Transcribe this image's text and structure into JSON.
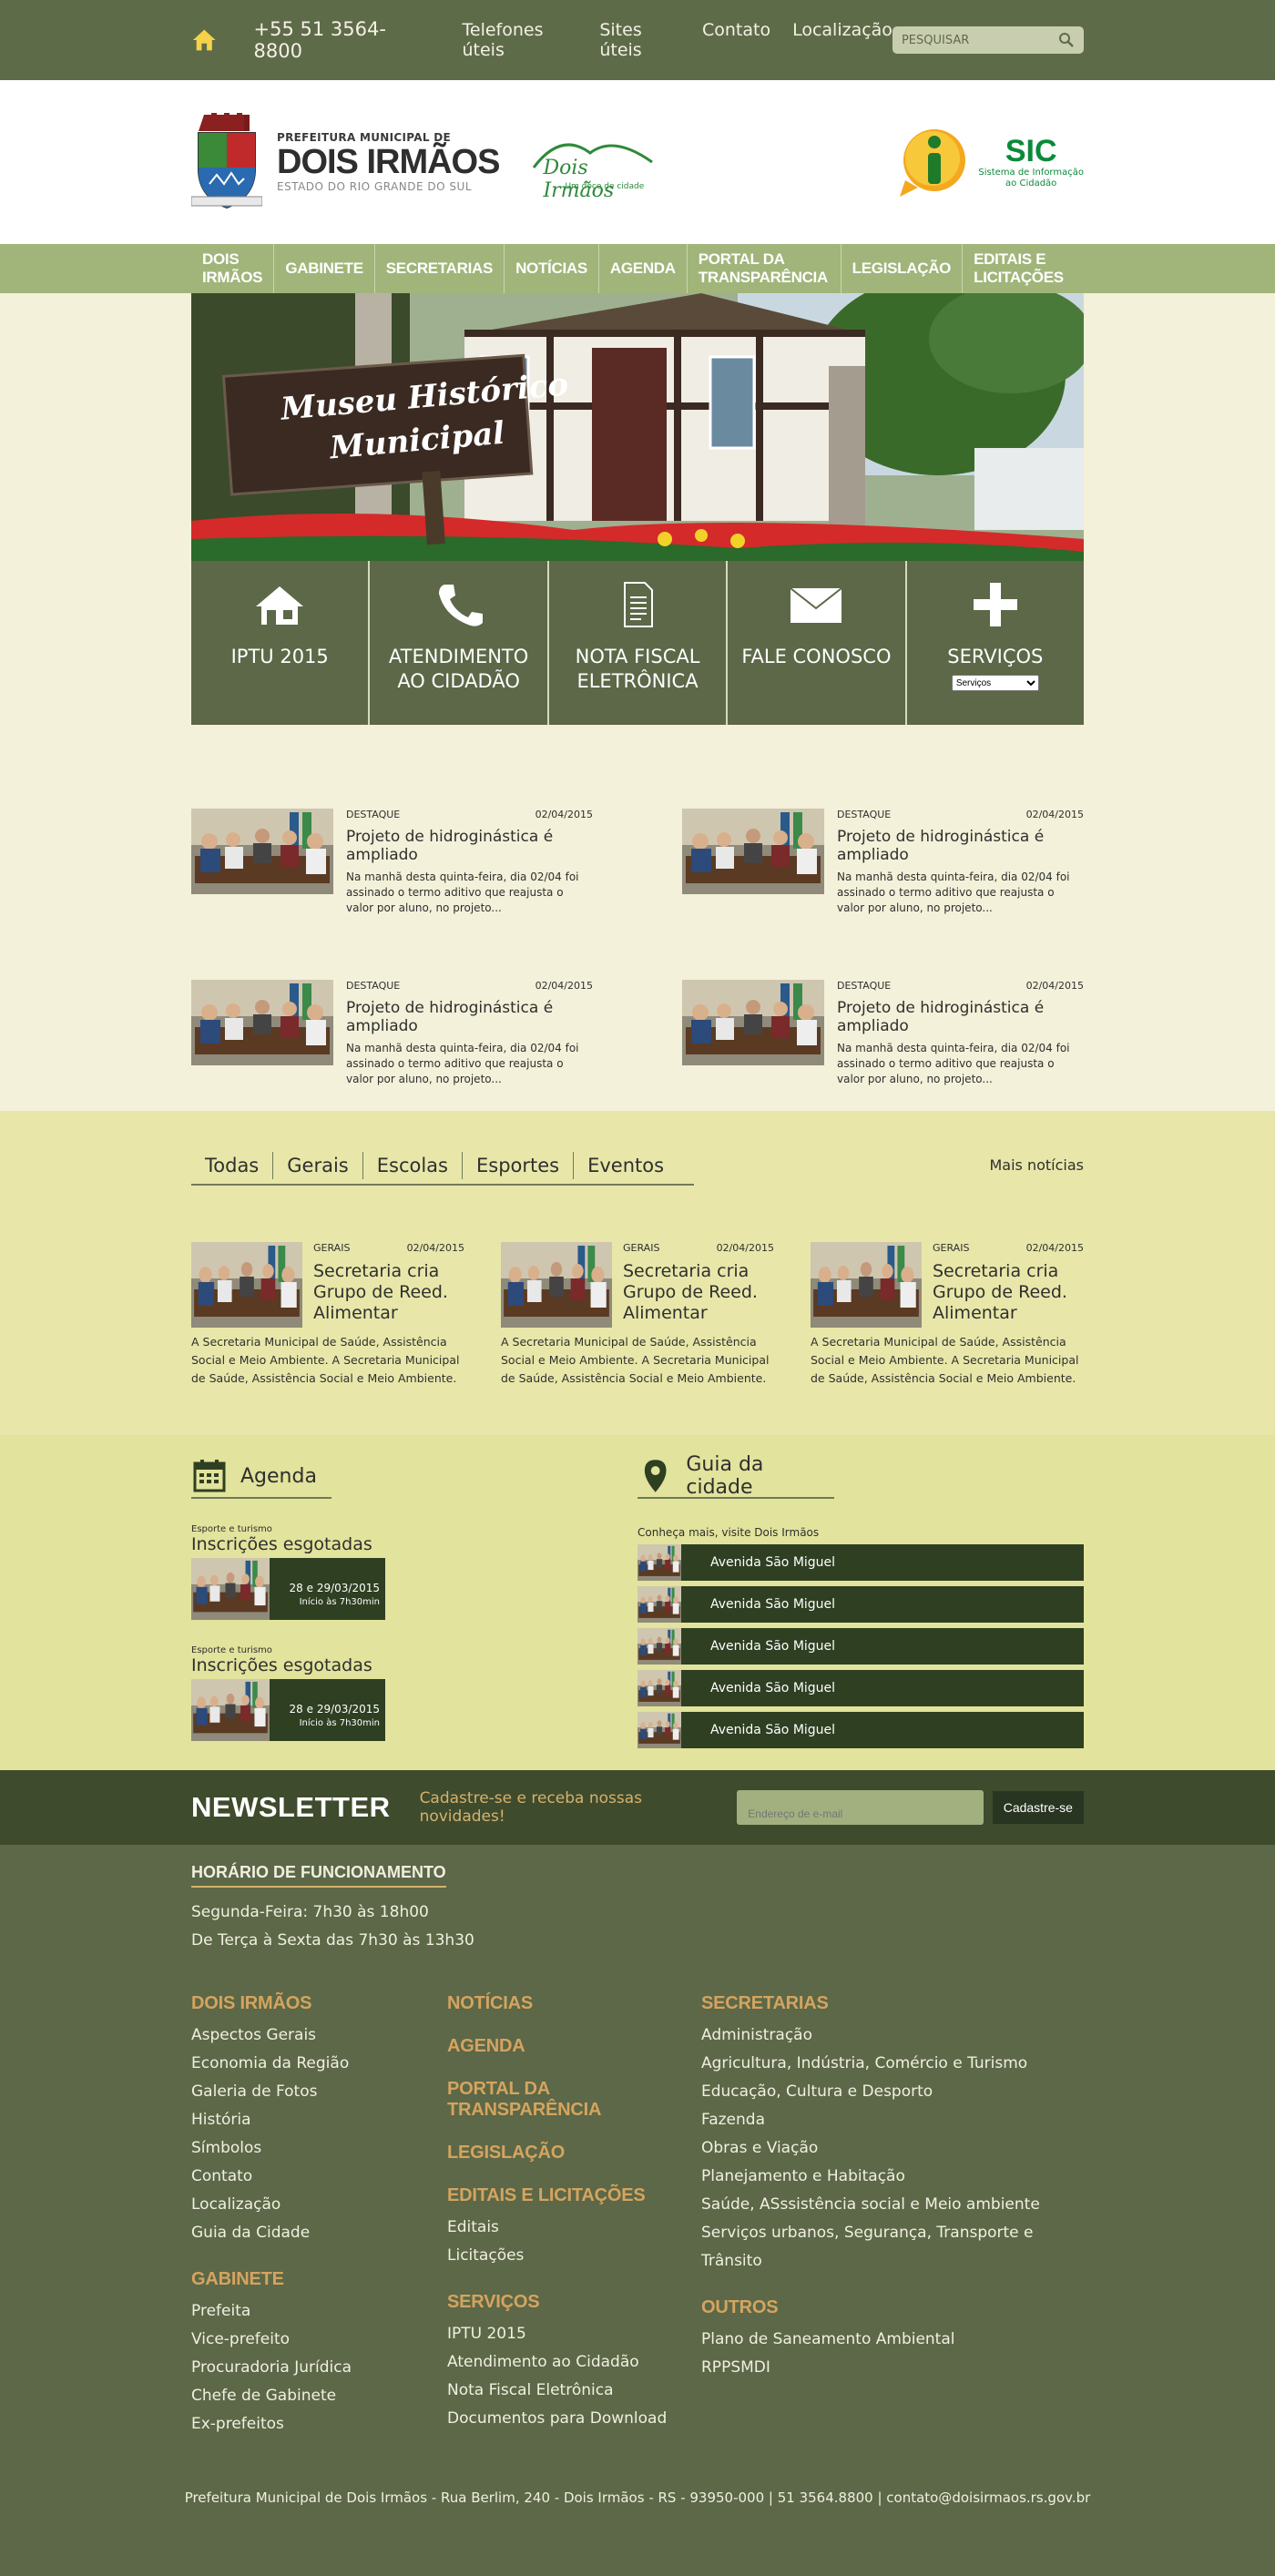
{
  "topbar": {
    "phone": "+55 51 3564-8800",
    "links": [
      "Telefones úteis",
      "Sites úteis",
      "Contato",
      "Localização"
    ],
    "search_placeholder": "PESQUISAR"
  },
  "brand": {
    "small": "PREFEITURA MUNICIPAL DE",
    "name": "DOIS IRMÃOS",
    "state": "ESTADO DO RIO GRANDE DO SUL",
    "doce": "Dois Irmãos",
    "doce_tag": "Um doce de cidade",
    "sic": "SIC",
    "sic_desc1": "Sistema de Informação",
    "sic_desc2": "ao Cidadão"
  },
  "nav": [
    "Dois Irmãos",
    "Gabinete",
    "Secretarias",
    "Notícias",
    "Agenda",
    "Portal da Transparência",
    "Legislação",
    "Editais e Licitações"
  ],
  "banner": {
    "line1": "Museu Histórico",
    "line2": "Municipal"
  },
  "tiles": [
    {
      "l1": "IPTU 2015",
      "l2": "",
      "icon": "house-icon"
    },
    {
      "l1": "ATENDIMENTO",
      "l2": "AO CIDADÃO",
      "icon": "phone-icon"
    },
    {
      "l1": "NOTA FISCAL",
      "l2": "ELETRÔNICA",
      "icon": "document-icon"
    },
    {
      "l1": "FALE CONOSCO",
      "l2": "",
      "icon": "envelope-icon"
    },
    {
      "l1": "SERVIÇOS",
      "l2": "",
      "icon": "plus-icon",
      "select": "Serviços"
    }
  ],
  "news_featured": [
    {
      "tag": "DESTAQUE",
      "date": "02/04/2015",
      "title": "Projeto de hidroginástica é ampliado",
      "desc": "Na manhã desta quinta-feira, dia 02/04 foi assinado o termo aditivo  que reajusta o valor por aluno, no projeto..."
    },
    {
      "tag": "DESTAQUE",
      "date": "02/04/2015",
      "title": "Projeto de hidroginástica é ampliado",
      "desc": "Na manhã desta quinta-feira, dia 02/04 foi assinado o termo aditivo  que reajusta o valor por aluno, no projeto..."
    },
    {
      "tag": "DESTAQUE",
      "date": "02/04/2015",
      "title": "Projeto de hidroginástica é ampliado",
      "desc": "Na manhã desta quinta-feira, dia 02/04 foi assinado o termo aditivo  que reajusta o valor por aluno, no projeto..."
    },
    {
      "tag": "DESTAQUE",
      "date": "02/04/2015",
      "title": "Projeto de hidroginástica é ampliado",
      "desc": "Na manhã desta quinta-feira, dia 02/04 foi assinado o termo aditivo  que reajusta o valor por aluno, no projeto..."
    }
  ],
  "tabs": [
    "Todas",
    "Gerais",
    "Escolas",
    "Esportes",
    "Eventos"
  ],
  "more_news": "Mais notícias",
  "news_general": [
    {
      "tag": "GERAIS",
      "date": "02/04/2015",
      "title": "Secretaria cria Grupo de Reed. Alimentar",
      "desc": "A Secretaria Municipal de Saúde, Assistência Social e Meio Ambiente.   A Secretaria Municipal de Saúde, Assistência Social e Meio Ambiente."
    },
    {
      "tag": "GERAIS",
      "date": "02/04/2015",
      "title": "Secretaria cria Grupo de Reed. Alimentar",
      "desc": "A Secretaria Municipal de Saúde, Assistência Social e Meio Ambiente.   A Secretaria Municipal de Saúde, Assistência Social e Meio Ambiente."
    },
    {
      "tag": "GERAIS",
      "date": "02/04/2015",
      "title": "Secretaria cria Grupo de Reed. Alimentar",
      "desc": "A Secretaria Municipal de Saúde, Assistência Social e Meio Ambiente.   A Secretaria Municipal de Saúde, Assistência Social e Meio Ambiente."
    }
  ],
  "agenda": {
    "title": "Agenda",
    "events": [
      {
        "cat": "Esporte e turismo",
        "name": "Inscrições esgotadas",
        "date": "28 e 29/03/2015",
        "time": "Início às 7h30min"
      },
      {
        "cat": "Esporte e turismo",
        "name": "Inscrições esgotadas",
        "date": "28 e 29/03/2015",
        "time": "Início às 7h30min"
      }
    ]
  },
  "guide": {
    "title": "Guia da cidade",
    "intro": "Conheça mais, visite Dois Irmãos",
    "items": [
      "Avenida São Miguel",
      "Avenida São Miguel",
      "Avenida São Miguel",
      "Avenida São Miguel",
      "Avenida São Miguel"
    ]
  },
  "newsletter": {
    "title": "NEWSLETTER",
    "subtitle": "Cadastre-se e receba nossas novidades!",
    "placeholder": "Endereço de e-mail",
    "button": "Cadastre-se"
  },
  "hours": {
    "title": "HORÁRIO DE FUNCIONAMENTO",
    "l1": "Segunda-Feira: 7h30 às 18h00",
    "l2": "De Terça à Sexta das 7h30 às 13h30"
  },
  "footer": {
    "c1": [
      {
        "h": "Dois Irmãos",
        "items": [
          "Aspectos Gerais",
          "Economia da Região",
          "Galeria de Fotos",
          "História",
          "Símbolos",
          "Contato",
          "Localização",
          "Guia da Cidade"
        ]
      },
      {
        "h": "Gabinete",
        "items": [
          "Prefeita",
          "Vice-prefeito",
          "Procuradoria Jurídica",
          "Chefe de Gabinete",
          "Ex-prefeitos"
        ]
      }
    ],
    "c2": [
      {
        "h": "Notícias",
        "items": []
      },
      {
        "h": "Agenda",
        "items": []
      },
      {
        "h": "Portal da Transparência",
        "items": []
      },
      {
        "h": "Legislação",
        "items": []
      },
      {
        "h": "Editais e Licitações",
        "items": [
          "Editais",
          "Licitações"
        ]
      },
      {
        "h": "Serviços",
        "items": [
          "IPTU 2015",
          "Atendimento ao Cidadão",
          "Nota Fiscal Eletrônica",
          "Documentos para Download"
        ]
      }
    ],
    "c3": [
      {
        "h": "Secretarias",
        "items": [
          "Administração",
          "Agricultura, Indústria, Comércio e  Turismo",
          "Educação, Cultura e Desporto",
          "Fazenda",
          "Obras e  Viação",
          "Planejamento e Habitação",
          "Saúde, ASssistência social e Meio ambiente",
          "Serviços urbanos, Segurança, Transporte e Trânsito"
        ]
      },
      {
        "h": "Outros",
        "items": [
          "Plano de Saneamento Ambiental",
          "RPPSMDI"
        ]
      }
    ],
    "copyright": "Prefeitura Municipal de Dois Irmãos - Rua Berlim, 240 - Dois Irmãos - RS - 93950-000  |  51 3564.8800  |  contato@doisirmaos.rs.gov.br"
  },
  "colors": {
    "olive": "#5c6847",
    "nav": "#a1b57a",
    "cream": "#f3f1d9",
    "yellow": "#e8e7a9",
    "dark": "#2f3f22",
    "gold": "#d5a45f"
  }
}
